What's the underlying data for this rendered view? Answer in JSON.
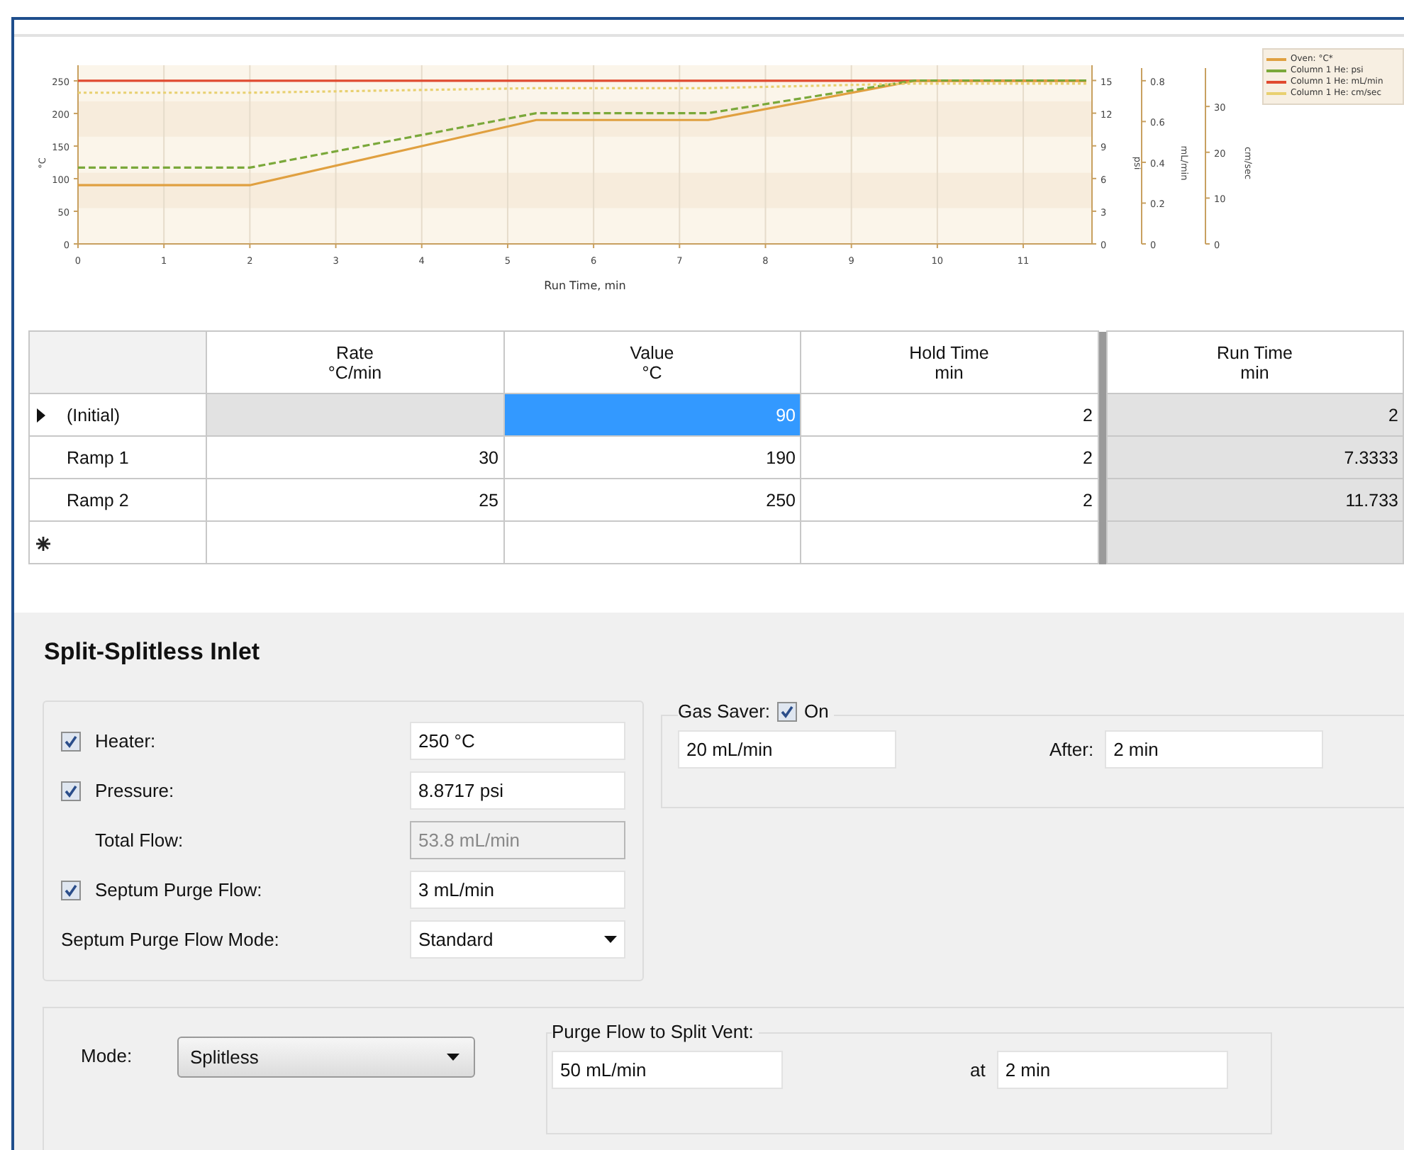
{
  "chart": {
    "chart_data": {
      "type": "line",
      "xlabel": "Run Time, min",
      "ylabel": "°C",
      "x": [
        0,
        2,
        5.333,
        7.333,
        9.733,
        11.733
      ],
      "xlim": [
        0,
        11.8
      ],
      "ylim": [
        0,
        274
      ],
      "xticks": [
        0,
        1,
        2,
        3,
        4,
        5,
        6,
        7,
        8,
        9,
        10,
        11
      ],
      "yticks": [
        0,
        50,
        100,
        150,
        200,
        250
      ],
      "grid": true,
      "y2label": "psi",
      "y2lim": [
        0,
        16.4
      ],
      "y2ticks": [
        0,
        3,
        6,
        9,
        12,
        15
      ],
      "y3label": "mL/min",
      "y3lim": [
        0,
        0.876
      ],
      "y3ticks": [
        0,
        0.2,
        0.4,
        0.6,
        0.8
      ],
      "series": [
        {
          "name": "Oven: °C*",
          "color": "#e0a040",
          "values": [
            90,
            90,
            190,
            190,
            250,
            250
          ]
        },
        {
          "name": "Column 1 He: psi",
          "color": "#7aa83a",
          "axis": "y2",
          "line_style": "dashed",
          "values": [
            7,
            7,
            12,
            12,
            15,
            15
          ]
        },
        {
          "name": "Column 1 He: mL/min",
          "color": "#e04a30",
          "axis": "y3",
          "values": [
            0.8,
            0.8,
            0.8,
            0.8,
            0.8,
            0.8
          ]
        }
      ]
    },
    "velocity_axis": {
      "chart_data": {
        "type": "line",
        "ylabel": "cm/sec",
        "x": [
          0,
          2,
          5.333,
          7.333,
          9.733,
          11.733
        ],
        "xlim": [
          0,
          11.8
        ],
        "ylim": [
          0,
          39
        ],
        "yticks": [
          0,
          10,
          20,
          30
        ],
        "series": [
          {
            "name": "Column 1 He: cm/sec",
            "color": "#e8d070",
            "line_style": "dotted",
            "values": [
              33,
              33,
              34,
              34,
              35,
              35
            ]
          }
        ]
      }
    }
  },
  "table": {
    "columns": [
      {
        "title": "Rate",
        "unit": "°C/min",
        "readonly": false
      },
      {
        "title": "Value",
        "unit": "°C",
        "readonly": false
      },
      {
        "title": "Hold Time",
        "unit": "min",
        "readonly": false
      },
      {
        "title": "Run Time",
        "unit": "min",
        "readonly": true
      }
    ],
    "rows": [
      {
        "kind": "data",
        "label": "(Initial)",
        "current": true,
        "cells": [
          {
            "disabled": true,
            "selected": false
          },
          {
            "value": "90",
            "disabled": false,
            "selected": true
          },
          {
            "value": "2",
            "disabled": false,
            "selected": false
          },
          {
            "value": "2",
            "disabled": true,
            "selected": false
          }
        ]
      },
      {
        "kind": "data",
        "label": "Ramp 1",
        "current": false,
        "cells": [
          {
            "value": "30",
            "disabled": false,
            "selected": false
          },
          {
            "value": "190",
            "disabled": false,
            "selected": false
          },
          {
            "value": "2",
            "disabled": false,
            "selected": false
          },
          {
            "value": "7.3333",
            "disabled": true,
            "selected": false
          }
        ]
      },
      {
        "kind": "data",
        "label": "Ramp 2",
        "current": false,
        "cells": [
          {
            "value": "25",
            "disabled": false,
            "selected": false
          },
          {
            "value": "250",
            "disabled": false,
            "selected": false
          },
          {
            "value": "2",
            "disabled": false,
            "selected": false
          },
          {
            "value": "11.733",
            "disabled": true,
            "selected": false
          }
        ]
      },
      {
        "kind": "new",
        "current": false,
        "cells": [
          {
            "disabled": false,
            "selected": false
          },
          {
            "disabled": false,
            "selected": false
          },
          {
            "disabled": false,
            "selected": false
          },
          {
            "disabled": true,
            "selected": false
          }
        ]
      }
    ]
  },
  "inlet": {
    "title": "Split-Splitless Inlet",
    "settings": [
      {
        "kind": "check",
        "label": "Heater:",
        "checked": true,
        "value": "250 °C",
        "disabled": false
      },
      {
        "kind": "check",
        "label": "Pressure:",
        "checked": true,
        "value": "8.8717 psi",
        "disabled": false
      },
      {
        "kind": "plain",
        "label": "Total Flow:",
        "value": "53.8 mL/min",
        "disabled": true
      },
      {
        "kind": "check",
        "label": "Septum Purge Flow:",
        "checked": true,
        "value": "3 mL/min",
        "disabled": false
      },
      {
        "kind": "select",
        "label": "Septum Purge Flow Mode:",
        "value": "Standard",
        "disabled": false
      }
    ],
    "gas_saver": {
      "label": "Gas Saver:",
      "checked": true,
      "check_label": "On",
      "flow": "20 mL/min",
      "after_label": "After:",
      "after": "2 min"
    },
    "mode": {
      "label": "Mode:",
      "value": "Splitless"
    },
    "purge": {
      "title": "Purge Flow to Split Vent:",
      "flow": "50 mL/min",
      "at_label": "at",
      "at": "2 min"
    }
  }
}
